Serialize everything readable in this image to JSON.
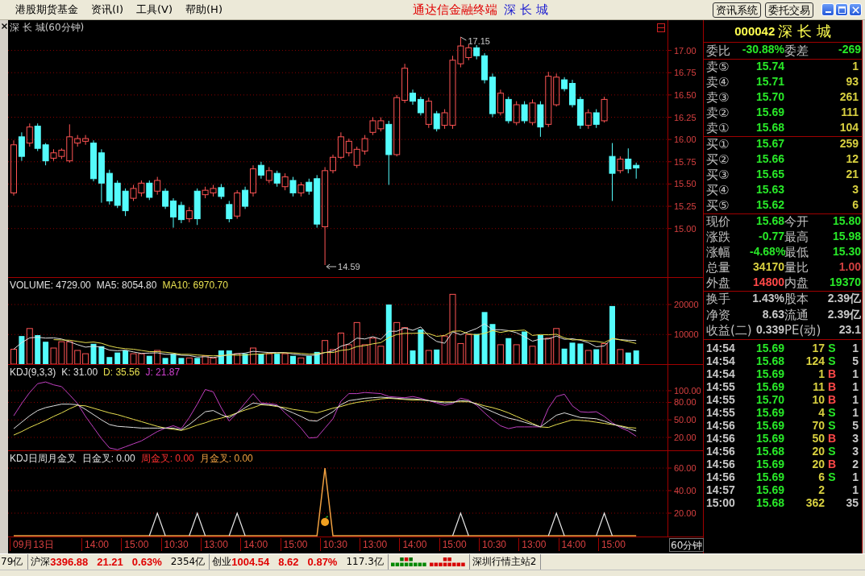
{
  "menu_bar": {
    "items": [
      "港股期货基金",
      "资讯(I)",
      "工具(V)",
      "帮助(H)"
    ],
    "title": "通达信金融终端",
    "stock": "深 长 城",
    "buttons": [
      "资讯系统",
      "委托交易"
    ]
  },
  "chart": {
    "title": "深 长 城(60分钟)",
    "price_panel": {
      "chart_data": {
        "type": "candlestick",
        "ohlc": [
          [
            15.4,
            15.99,
            15.37,
            15.94
          ],
          [
            16.03,
            16.08,
            15.76,
            15.81
          ],
          [
            15.96,
            16.18,
            15.92,
            16.14
          ],
          [
            16.15,
            16.18,
            15.87,
            15.9
          ],
          [
            15.94,
            15.96,
            15.71,
            15.76
          ],
          [
            15.79,
            15.89,
            15.76,
            15.85
          ],
          [
            15.81,
            15.9,
            15.78,
            15.88
          ],
          [
            15.76,
            16.17,
            15.74,
            16.03
          ],
          [
            15.96,
            16.05,
            15.92,
            16.01
          ],
          [
            15.98,
            16.05,
            15.94,
            16.01
          ],
          [
            15.96,
            15.99,
            15.53,
            15.56
          ],
          [
            15.85,
            15.89,
            15.29,
            15.51
          ],
          [
            15.62,
            15.66,
            15.27,
            15.31
          ],
          [
            15.51,
            15.54,
            15.23,
            15.26
          ],
          [
            15.42,
            15.45,
            15.14,
            15.2
          ],
          [
            15.34,
            15.49,
            15.31,
            15.45
          ],
          [
            15.4,
            15.54,
            15.36,
            15.51
          ],
          [
            15.51,
            15.54,
            15.32,
            15.35
          ],
          [
            15.42,
            15.58,
            15.38,
            15.54
          ],
          [
            15.42,
            15.45,
            15.22,
            15.25
          ],
          [
            15.31,
            15.34,
            15.01,
            15.13
          ],
          [
            15.26,
            15.3,
            15.06,
            15.1
          ],
          [
            15.11,
            15.24,
            15.07,
            15.2
          ],
          [
            15.42,
            15.45,
            15.04,
            15.11
          ],
          [
            15.38,
            15.47,
            15.34,
            15.43
          ],
          [
            15.4,
            15.49,
            15.36,
            15.45
          ],
          [
            15.46,
            15.5,
            15.33,
            15.36
          ],
          [
            15.27,
            15.31,
            15.07,
            15.11
          ],
          [
            15.14,
            15.43,
            15.11,
            15.4
          ],
          [
            15.43,
            15.47,
            15.22,
            15.25
          ],
          [
            15.4,
            15.71,
            15.36,
            15.67
          ],
          [
            15.71,
            15.75,
            15.56,
            15.6
          ],
          [
            15.54,
            15.69,
            15.51,
            15.65
          ],
          [
            15.62,
            15.65,
            15.47,
            15.51
          ],
          [
            15.47,
            15.62,
            15.43,
            15.58
          ],
          [
            15.54,
            15.58,
            15.36,
            15.4
          ],
          [
            15.4,
            15.52,
            15.36,
            15.49
          ],
          [
            15.52,
            15.56,
            15.38,
            15.42
          ],
          [
            15.56,
            15.6,
            15.01,
            15.05
          ],
          [
            15.02,
            15.69,
            14.59,
            15.65
          ],
          [
            15.65,
            15.83,
            15.62,
            15.8
          ],
          [
            15.8,
            16.08,
            15.78,
            16.03
          ],
          [
            15.85,
            16.01,
            15.81,
            15.98
          ],
          [
            15.71,
            15.92,
            15.68,
            15.89
          ],
          [
            15.87,
            16.05,
            15.83,
            16.01
          ],
          [
            16.08,
            16.25,
            16.05,
            16.21
          ],
          [
            16.12,
            16.25,
            16.09,
            16.21
          ],
          [
            16.17,
            16.21,
            15.49,
            15.83
          ],
          [
            15.83,
            16.5,
            15.81,
            16.47
          ],
          [
            16.44,
            16.85,
            16.41,
            16.8
          ],
          [
            16.52,
            16.56,
            16.39,
            16.43
          ],
          [
            16.45,
            16.48,
            16.27,
            16.3
          ],
          [
            16.17,
            16.47,
            16.13,
            16.43
          ],
          [
            16.29,
            16.32,
            16.09,
            16.12
          ],
          [
            16.16,
            16.34,
            16.12,
            16.3
          ],
          [
            16.16,
            16.94,
            16.12,
            16.89
          ],
          [
            16.85,
            17.15,
            16.81,
            17.05
          ],
          [
            16.92,
            17.07,
            16.89,
            17.03
          ],
          [
            17.03,
            17.06,
            16.9,
            16.94
          ],
          [
            16.94,
            16.97,
            16.63,
            16.67
          ],
          [
            16.7,
            16.74,
            16.25,
            16.29
          ],
          [
            16.3,
            16.56,
            16.27,
            16.52
          ],
          [
            16.45,
            16.48,
            16.18,
            16.21
          ],
          [
            16.19,
            16.43,
            16.16,
            16.39
          ],
          [
            16.39,
            16.43,
            16.18,
            16.21
          ],
          [
            16.19,
            16.45,
            16.16,
            16.41
          ],
          [
            16.39,
            16.43,
            16.03,
            16.14
          ],
          [
            16.17,
            16.76,
            16.14,
            16.71
          ],
          [
            16.39,
            16.74,
            16.37,
            16.7
          ],
          [
            16.67,
            16.7,
            16.54,
            16.57
          ],
          [
            16.63,
            16.67,
            16.36,
            16.39
          ],
          [
            16.45,
            16.48,
            16.12,
            16.16
          ],
          [
            16.16,
            16.34,
            16.12,
            16.3
          ],
          [
            16.3,
            16.34,
            16.13,
            16.17
          ],
          [
            16.21,
            16.48,
            16.19,
            16.45
          ],
          [
            15.81,
            15.96,
            15.31,
            15.62
          ],
          [
            15.65,
            15.81,
            15.62,
            15.78
          ],
          [
            15.78,
            15.9,
            15.62,
            15.67
          ],
          [
            15.71,
            15.74,
            15.56,
            15.68
          ]
        ],
        "ylim": [
          14.45,
          17.34
        ],
        "yticks": [
          {
            "value": 17,
            "label": "17.00"
          },
          {
            "value": 16.75,
            "label": "16.75"
          },
          {
            "value": 16.5,
            "label": "16.50"
          },
          {
            "value": 16.25,
            "label": "16.25"
          },
          {
            "value": 16,
            "label": "16.00"
          },
          {
            "value": 15.75,
            "label": "15.75"
          },
          {
            "value": 15.5,
            "label": "15.50"
          },
          {
            "value": 15.25,
            "label": "15.25"
          },
          {
            "value": 15,
            "label": "15.00"
          }
        ],
        "grid": true,
        "annotations": [
          "17.15",
          "14.59"
        ]
      }
    },
    "volume_panel": {
      "legend": [
        {
          "text": "VOLUME: 4729.00",
          "color": "#e0e0e0"
        },
        {
          "text": "MA5: 8054.80",
          "color": "#e0e0e0"
        },
        {
          "text": "MA10: 6970.70",
          "color": "#e8e050"
        }
      ],
      "chart_data": {
        "type": "bar",
        "series": [
          {
            "values": [
              5100,
              9500,
              12000,
              9800,
              7600,
              5500,
              7600,
              7600,
              4700,
              3600,
              6900,
              6100,
              2500,
              4000,
              4700,
              3600,
              3600,
              2900,
              4700,
              2200,
              3600,
              2200,
              2200,
              2200,
              2900,
              2200,
              4700,
              4700,
              3600,
              3600,
              5500,
              3600,
              3600,
              3600,
              3600,
              2900,
              2200,
              2900,
              4200,
              8000,
              5000,
              10500,
              6600,
              14000,
              6600,
              8800,
              6100,
              20000,
              14000,
              12300,
              4700,
              11700,
              4700,
              5000,
              9500,
              23400,
              7000,
              10000,
              10200,
              17500,
              13500,
              6600,
              8800,
              6600,
              11000,
              6100,
              9800,
              8800,
              12000,
              5300,
              7300,
              7000,
              4700,
              5100,
              7000,
              19500,
              5000,
              4000,
              4700
            ],
            "colors": [
              "#ff5454",
              "#54fcfc",
              "#ff5454",
              "#54fcfc",
              "#54fcfc",
              "#ff5454",
              "#ff5454",
              "#ff5454",
              "#ff5454",
              "#ff5454",
              "#54fcfc",
              "#54fcfc",
              "#54fcfc",
              "#54fcfc",
              "#54fcfc",
              "#ff5454",
              "#ff5454",
              "#54fcfc",
              "#ff5454",
              "#54fcfc",
              "#54fcfc",
              "#54fcfc",
              "#ff5454",
              "#54fcfc",
              "#ff5454",
              "#ff5454",
              "#54fcfc",
              "#54fcfc",
              "#ff5454",
              "#54fcfc",
              "#ff5454",
              "#54fcfc",
              "#ff5454",
              "#54fcfc",
              "#ff5454",
              "#54fcfc",
              "#ff5454",
              "#54fcfc",
              "#54fcfc",
              "#ff5454",
              "#ff5454",
              "#ff5454",
              "#ff5454",
              "#ff5454",
              "#ff5454",
              "#ff5454",
              "#ff5454",
              "#54fcfc",
              "#ff5454",
              "#ff5454",
              "#54fcfc",
              "#54fcfc",
              "#ff5454",
              "#54fcfc",
              "#ff5454",
              "#ff5454",
              "#ff5454",
              "#ff5454",
              "#54fcfc",
              "#54fcfc",
              "#54fcfc",
              "#ff5454",
              "#54fcfc",
              "#ff5454",
              "#54fcfc",
              "#ff5454",
              "#54fcfc",
              "#ff5454",
              "#ff5454",
              "#54fcfc",
              "#54fcfc",
              "#54fcfc",
              "#ff5454",
              "#54fcfc",
              "#ff5454",
              "#54fcfc",
              "#ff5454",
              "#54fcfc",
              "#54fcfc"
            ]
          },
          {
            "type": "line",
            "color": "#e0e0e0",
            "values": [
              5100,
              7300,
              8900,
              9100,
              8800,
              8900,
              8500,
              7600,
              6600,
              5800,
              6100,
              5800,
              4800,
              4600,
              4800,
              4200,
              3700,
              3800,
              3900,
              3400,
              3400,
              3100,
              3000,
              2500,
              2600,
              2300,
              2800,
              3300,
              3600,
              3800,
              4400,
              4200,
              4000,
              4000,
              4000,
              3500,
              3200,
              3000,
              3200,
              4000,
              4500,
              6100,
              6900,
              8800,
              8500,
              9300,
              8400,
              11100,
              11100,
              12200,
              11400,
              12500,
              9500,
              7700,
              7100,
              10900,
              9900,
              11000,
              12000,
              13600,
              11600,
              11600,
              11300,
              10600,
              9300,
              7800,
              8500,
              8500,
              9500,
              8400,
              8600,
              8100,
              7300,
              5900,
              6200,
              8700,
              8300,
              8100,
              8000
            ]
          },
          {
            "type": "line",
            "color": "#e8e050",
            "values": [
              null,
              null,
              null,
              null,
              null,
              8300,
              8200,
              8100,
              7700,
              7300,
              7500,
              7100,
              6200,
              5600,
              5300,
              5100,
              4700,
              4300,
              4300,
              4100,
              3800,
              3400,
              3400,
              3200,
              3000,
              2900,
              3000,
              3200,
              3100,
              3200,
              3400,
              3500,
              3700,
              3800,
              3900,
              3900,
              3700,
              3500,
              3600,
              4000,
              4000,
              4700,
              5000,
              6000,
              6300,
              6900,
              7300,
              9000,
              10000,
              10400,
              10400,
              10500,
              10300,
              9400,
              9700,
              11100,
              11200,
              10200,
              9900,
              10400,
              11300,
              10700,
              11200,
              11300,
              11500,
              9700,
              10000,
              9900,
              10100,
              8900,
              8200,
              8300,
              7900,
              7700,
              7300,
              8700,
              8200,
              7700,
              7000
            ]
          }
        ],
        "ylim": [
          0,
          29000
        ],
        "yticks": [
          20000,
          10000
        ],
        "grid": true
      }
    },
    "kdj_panel": {
      "legend": [
        {
          "text": "KDJ(9,3,3)",
          "color": "#e0e0e0"
        },
        {
          "text": "K: 31.00",
          "color": "#e0e0e0"
        },
        {
          "text": "D: 35.56",
          "color": "#e8e050"
        },
        {
          "text": "J: 21.87",
          "color": "#d040d0"
        }
      ],
      "chart_data": {
        "type": "line",
        "series": [
          {
            "color": "#e0e0e0",
            "values": [
              35,
              46,
              57,
              66,
              71,
              74,
              77,
              77,
              76,
              68,
              59,
              50,
              42,
              39,
              38,
              37,
              36,
              36,
              36,
              36,
              36,
              33,
              42,
              53,
              64,
              66,
              59,
              54,
              62,
              71,
              79,
              77,
              76,
              74,
              68,
              62,
              56,
              49,
              48,
              56,
              64,
              76,
              83,
              85,
              87,
              88,
              89,
              88,
              87,
              86,
              86,
              85,
              83,
              81,
              79,
              80,
              83,
              82,
              77,
              70,
              64,
              58,
              53,
              50,
              46,
              42,
              38,
              48,
              58,
              62,
              58,
              54,
              53,
              52,
              48,
              43,
              39,
              35,
              31
            ]
          },
          {
            "color": "#e8e050",
            "values": [
              24,
              30,
              37,
              43,
              49,
              56,
              62,
              69,
              75,
              74,
              70,
              66,
              62,
              59,
              55,
              51,
              47,
              43,
              39,
              36,
              34,
              32,
              36,
              41,
              45,
              50,
              53,
              57,
              62,
              67,
              71,
              76,
              75,
              73,
              71,
              68,
              66,
              64,
              62,
              66,
              70,
              73,
              77,
              80,
              82,
              84,
              86,
              87,
              86,
              85,
              84,
              84,
              83,
              82,
              81,
              81,
              81,
              81,
              78,
              74,
              71,
              67,
              62,
              56,
              50,
              44,
              38,
              37,
              42,
              46,
              50,
              49,
              48,
              46,
              44,
              42,
              40,
              37,
              36
            ]
          },
          {
            "color": "#c040c0",
            "values": [
              57,
              78,
              97,
              112,
              115,
              110,
              107,
              93,
              78,
              56,
              37,
              18,
              2,
              -1,
              4,
              9,
              14,
              22,
              30,
              36,
              40,
              35,
              54,
              77,
              102,
              98,
              71,
              48,
              62,
              79,
              95,
              79,
              78,
              76,
              62,
              50,
              36,
              19,
              20,
              36,
              52,
              82,
              95,
              95,
              97,
              96,
              95,
              90,
              89,
              88,
              90,
              87,
              83,
              79,
              75,
              78,
              87,
              84,
              75,
              62,
              50,
              40,
              35,
              38,
              38,
              38,
              38,
              70,
              90,
              94,
              74,
              64,
              63,
              64,
              56,
              45,
              37,
              31,
              22
            ]
          }
        ],
        "ylim": [
          -2.8,
          144.8
        ],
        "yticks": [
          {
            "value": 100,
            "label": "100.00"
          },
          {
            "value": 80,
            "label": "80.00"
          },
          {
            "value": 50,
            "label": "50.00"
          },
          {
            "value": 20,
            "label": "20.00"
          }
        ],
        "grid": true
      }
    },
    "cross_panel": {
      "legend": [
        {
          "text": "KDJ日周月金叉",
          "color": "#e0e0e0"
        },
        {
          "text": "日金叉: 0.00",
          "color": "#e0e0e0"
        },
        {
          "text": "周金叉: 0.00",
          "color": "#ff3030"
        },
        {
          "text": "月金叉: 0.00",
          "color": "#f0a040"
        }
      ],
      "chart_data": {
        "type": "line",
        "series": [
          {
            "color": "#e8e8e8",
            "values": [
              null,
              null,
              null,
              null,
              null,
              null,
              null,
              null,
              null,
              null,
              null,
              null,
              null,
              null,
              null,
              null,
              null,
              0,
              20,
              0,
              null,
              null,
              0,
              20,
              0,
              null,
              null,
              0,
              20,
              0,
              null,
              null,
              null,
              null,
              null,
              null,
              null,
              null,
              null,
              null,
              null,
              null,
              null,
              null,
              null,
              null,
              null,
              null,
              null,
              null,
              null,
              null,
              null,
              null,
              null,
              0,
              20,
              0,
              null,
              null,
              null,
              null,
              null,
              null,
              null,
              null,
              null,
              0,
              20,
              0,
              null,
              null,
              null,
              0,
              20,
              0,
              null,
              null,
              null
            ]
          },
          {
            "color": "#f0a040",
            "values": [
              0,
              0,
              0,
              0,
              0,
              0,
              0,
              0,
              0,
              0,
              0,
              0,
              0,
              0,
              0,
              0,
              0,
              0,
              0,
              0,
              0,
              0,
              0,
              0,
              0,
              0,
              0,
              0,
              0,
              0,
              0,
              0,
              0,
              0,
              0,
              0,
              0,
              0,
              0,
              60,
              0,
              0,
              0,
              0,
              0,
              0,
              0,
              0,
              0,
              0,
              0,
              0,
              0,
              0,
              0,
              0,
              0,
              0,
              0,
              0,
              0,
              0,
              0,
              0,
              0,
              0,
              0,
              0,
              0,
              0,
              0,
              0,
              0,
              0,
              0,
              0,
              0,
              0,
              0
            ]
          }
        ],
        "ylim": [
          -1.1,
          75.4
        ],
        "yticks": [
          {
            "value": 60,
            "label": "60.00"
          },
          {
            "value": 40,
            "label": "40.00"
          },
          {
            "value": 20,
            "label": "20.00"
          }
        ],
        "grid": true
      }
    },
    "time_axis": {
      "labels": [
        "09月13日",
        "14:00",
        "15:00",
        "10:30",
        "13:00",
        "14:00",
        "15:00",
        "10:30",
        "13:00",
        "14:00",
        "15:00",
        "10:30",
        "13:00",
        "14:00",
        "15:00"
      ],
      "period": "60分钟"
    }
  },
  "quote_panel": {
    "code": "000042",
    "name": "深 长 城",
    "ratio": [
      {
        "label": "委比",
        "value": "-30.88%"
      },
      {
        "label": "委差",
        "value": "-269"
      }
    ],
    "asks": [
      {
        "label": "卖⑤",
        "price": "15.74",
        "volume": "1"
      },
      {
        "label": "卖④",
        "price": "15.71",
        "volume": "93"
      },
      {
        "label": "卖③",
        "price": "15.70",
        "volume": "261"
      },
      {
        "label": "卖②",
        "price": "15.69",
        "volume": "111"
      },
      {
        "label": "卖①",
        "price": "15.68",
        "volume": "104"
      }
    ],
    "bids": [
      {
        "label": "买①",
        "price": "15.67",
        "volume": "259"
      },
      {
        "label": "买②",
        "price": "15.66",
        "volume": "12"
      },
      {
        "label": "买③",
        "price": "15.65",
        "volume": "21"
      },
      {
        "label": "买④",
        "price": "15.63",
        "volume": "3"
      },
      {
        "label": "买⑤",
        "price": "15.62",
        "volume": "6"
      }
    ],
    "stats": [
      {
        "label": "现价",
        "value": "15.68",
        "color": "#28e828"
      },
      {
        "label": "今开",
        "value": "15.80",
        "color": "#28e828"
      },
      {
        "label": "涨跌",
        "value": "-0.77",
        "color": "#28e828"
      },
      {
        "label": "最高",
        "value": "15.98",
        "color": "#28e828"
      },
      {
        "label": "涨幅",
        "value": "-4.68%",
        "color": "#28e828"
      },
      {
        "label": "最低",
        "value": "15.30",
        "color": "#28e828"
      },
      {
        "label": "总量",
        "value": "34170",
        "color": "#d8d040"
      },
      {
        "label": "量比",
        "value": "1.00",
        "color": "#d04040"
      },
      {
        "label": "外盘",
        "value": "14800",
        "color": "#ff4848"
      },
      {
        "label": "内盘",
        "value": "19370",
        "color": "#28e828"
      }
    ],
    "fundamentals": [
      {
        "label": "换手",
        "value": "1.43%"
      },
      {
        "label": "股本",
        "value": "2.39亿"
      },
      {
        "label": "净资",
        "value": "8.63"
      },
      {
        "label": "流通",
        "value": "2.39亿"
      },
      {
        "label": "收益(二)",
        "value": "0.339"
      },
      {
        "label": "PE(动)",
        "value": "23.1"
      }
    ],
    "ticks": [
      {
        "time": "14:54",
        "price": "15.69",
        "volume": "17",
        "side": "S",
        "count": "1",
        "kind": "sell"
      },
      {
        "time": "14:54",
        "price": "15.68",
        "volume": "124",
        "side": "S",
        "count": "5",
        "kind": "sell"
      },
      {
        "time": "14:54",
        "price": "15.69",
        "volume": "1",
        "side": "B",
        "count": "1",
        "kind": "buy"
      },
      {
        "time": "14:55",
        "price": "15.69",
        "volume": "11",
        "side": "B",
        "count": "1",
        "kind": "buy"
      },
      {
        "time": "14:55",
        "price": "15.70",
        "volume": "10",
        "side": "B",
        "count": "1",
        "kind": "buy"
      },
      {
        "time": "14:55",
        "price": "15.69",
        "volume": "4",
        "side": "S",
        "count": "1",
        "kind": "sell"
      },
      {
        "time": "14:56",
        "price": "15.69",
        "volume": "70",
        "side": "S",
        "count": "5",
        "kind": "sell"
      },
      {
        "time": "14:56",
        "price": "15.69",
        "volume": "50",
        "side": "B",
        "count": "3",
        "kind": "buy"
      },
      {
        "time": "14:56",
        "price": "15.68",
        "volume": "20",
        "side": "S",
        "count": "3",
        "kind": "sell"
      },
      {
        "time": "14:56",
        "price": "15.69",
        "volume": "20",
        "side": "B",
        "count": "2",
        "kind": "buy"
      },
      {
        "time": "14:56",
        "price": "15.69",
        "volume": "6",
        "side": "S",
        "count": "1",
        "kind": "sell"
      },
      {
        "time": "14:57",
        "price": "15.69",
        "volume": "2",
        "count": "1",
        "kind": "none"
      },
      {
        "time": "15:00",
        "price": "15.68",
        "volume": "362",
        "count": "35",
        "kind": "none"
      }
    ]
  },
  "status_bar": {
    "amount": "79亿",
    "indices": [
      {
        "name": "沪深",
        "value": "3396.88",
        "change": "21.21",
        "percent": "0.63%",
        "amount": "2354亿",
        "up": true
      },
      {
        "name": "创业",
        "value": "1004.54",
        "change": "8.62",
        "percent": "0.87%",
        "amount": "117.3亿",
        "up": true
      }
    ],
    "server": "深圳行情主站2"
  }
}
